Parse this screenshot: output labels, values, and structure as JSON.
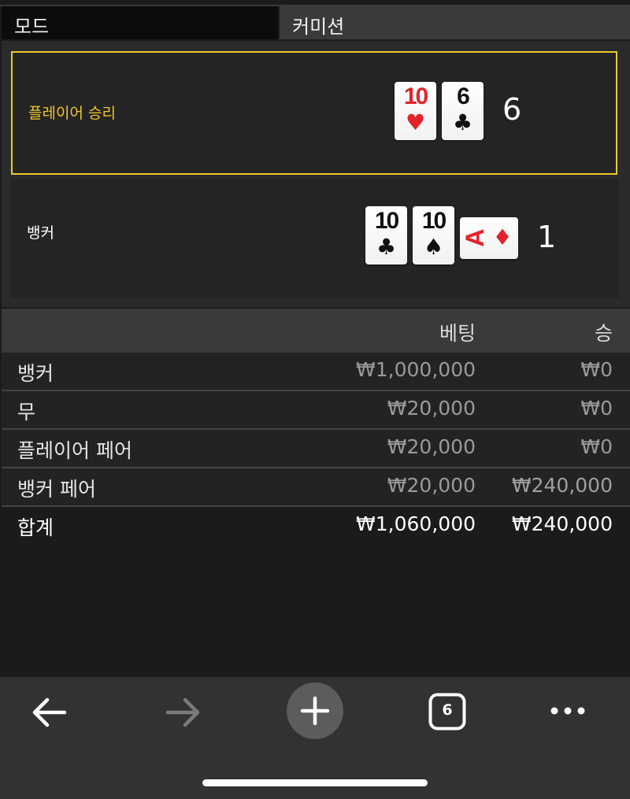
{
  "mode": {
    "label": "모드",
    "value": "커미션"
  },
  "player": {
    "label": "플레이어 승리",
    "total": "6",
    "cards": [
      {
        "rank": "10",
        "suit": "♥",
        "color": "red"
      },
      {
        "rank": "6",
        "suit": "♣",
        "color": "black"
      }
    ]
  },
  "banker": {
    "label": "뱅커",
    "total": "1",
    "cards": [
      {
        "rank": "10",
        "suit": "♣",
        "color": "black"
      },
      {
        "rank": "10",
        "suit": "♠",
        "color": "black"
      },
      {
        "rank": "A",
        "suit": "♦",
        "color": "red",
        "rotated": true
      }
    ]
  },
  "table": {
    "headers": {
      "name": "",
      "bet": "베팅",
      "win": "승"
    },
    "rows": [
      {
        "name": "뱅커",
        "bet": "₩1,000,000",
        "win": "₩0"
      },
      {
        "name": "무",
        "bet": "₩20,000",
        "win": "₩0"
      },
      {
        "name": "플레이어 페어",
        "bet": "₩20,000",
        "win": "₩0"
      },
      {
        "name": "뱅커 페어",
        "bet": "₩20,000",
        "win": "₩240,000"
      }
    ],
    "total": {
      "name": "합계",
      "bet": "₩1,060,000",
      "win": "₩240,000"
    }
  },
  "toolbar": {
    "back_icon": "arrow-left-icon",
    "forward_icon": "arrow-right-icon",
    "new_tab_icon": "plus-icon",
    "tab_count": "6",
    "more_icon": "ellipsis-icon"
  },
  "colors": {
    "highlight": "#ebc92c",
    "card_red": "#e2232b",
    "card_black": "#111111"
  }
}
